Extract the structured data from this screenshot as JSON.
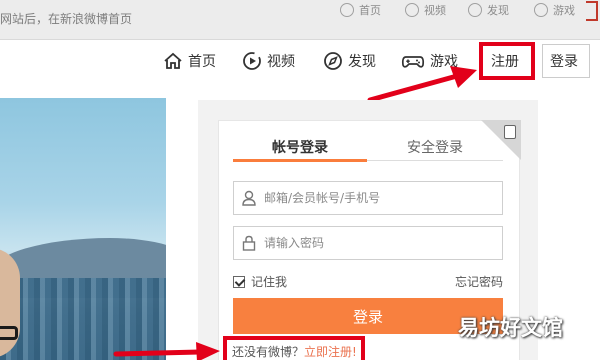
{
  "top": {
    "tip": "网站后，在新浪微博首页",
    "faded_nav": [
      "首页",
      "视频",
      "发现",
      "游戏"
    ]
  },
  "nav": {
    "home": "首页",
    "video": "视频",
    "discover": "发现",
    "game": "游戏",
    "register": "注册",
    "login": "登录"
  },
  "login_panel": {
    "tab_account": "帐号登录",
    "tab_secure": "安全登录",
    "username_placeholder": "邮箱/会员帐号/手机号",
    "password_placeholder": "请输入密码",
    "remember_label": "记住我",
    "forgot_label": "忘记密码",
    "login_button": "登录",
    "no_account_text": "还没有微博？",
    "register_link": "立即注册!"
  },
  "watermark": "易坊好文馆",
  "colors": {
    "accent": "#f8803f",
    "highlight_red": "#e2001a",
    "link": "#eb7350"
  }
}
